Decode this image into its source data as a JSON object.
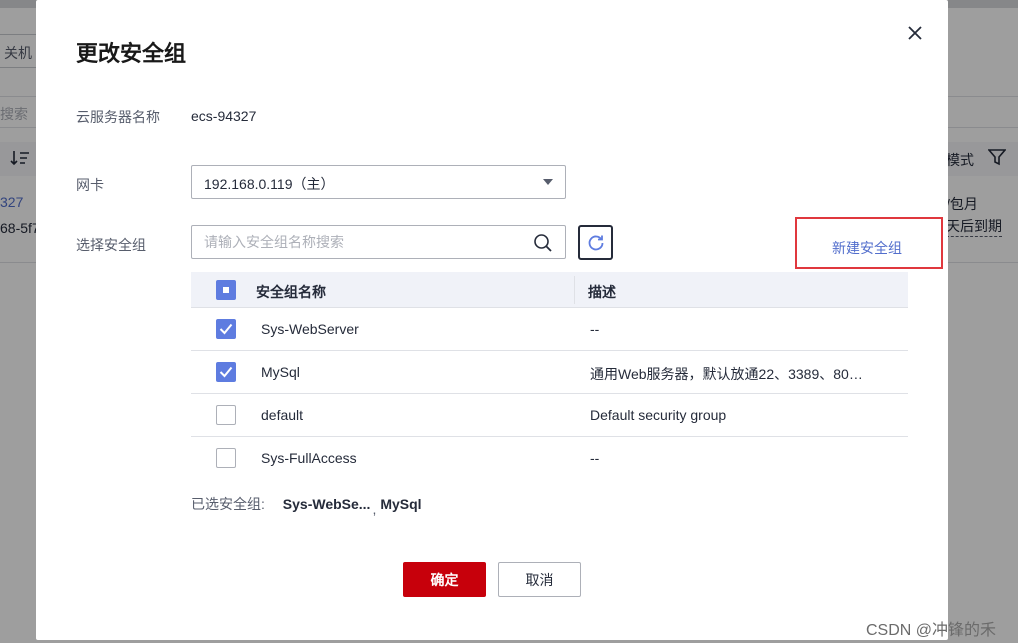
{
  "background": {
    "shutdown_button": "关机",
    "search_placeholder_fragment": "搜索",
    "sort_icon": "sort-icon",
    "mode_label": "模式",
    "filter_icon": "filter-icon",
    "instance_link_fragment": "327",
    "instance_id_fragment": "68-5f7",
    "billing_text": "/包月",
    "expire_text": "天后到期"
  },
  "modal": {
    "title": "更改安全组",
    "close_icon": "close-icon",
    "server_name_label": "云服务器名称",
    "server_name": "ecs-94327",
    "nic_label": "网卡",
    "nic_value": "192.168.0.119（主）",
    "sg_label": "选择安全组",
    "search_placeholder": "请输入安全组名称搜索",
    "refresh_icon": "refresh-icon",
    "new_sg_link": "新建安全组",
    "table": {
      "columns": [
        "安全组名称",
        "描述"
      ],
      "rows": [
        {
          "name": "Sys-WebServer",
          "description": "--",
          "checked": true
        },
        {
          "name": "MySql",
          "description": "通用Web服务器，默认放通22、3389、80…",
          "checked": true
        },
        {
          "name": "default",
          "description": "Default security group",
          "checked": false
        },
        {
          "name": "Sys-FullAccess",
          "description": "--",
          "checked": false
        }
      ]
    },
    "selected_label": "已选安全组:",
    "selected_items": [
      "Sys-WebSe...",
      "MySql"
    ],
    "selected_separator": ",",
    "confirm_button": "确定",
    "cancel_button": "取消"
  },
  "watermark": "CSDN @冲锋的禾",
  "colors": {
    "primary_blue": "#5e7ce0",
    "link_blue": "#526ecc",
    "confirm_red": "#c7000b",
    "highlight_red": "#e0383e"
  }
}
